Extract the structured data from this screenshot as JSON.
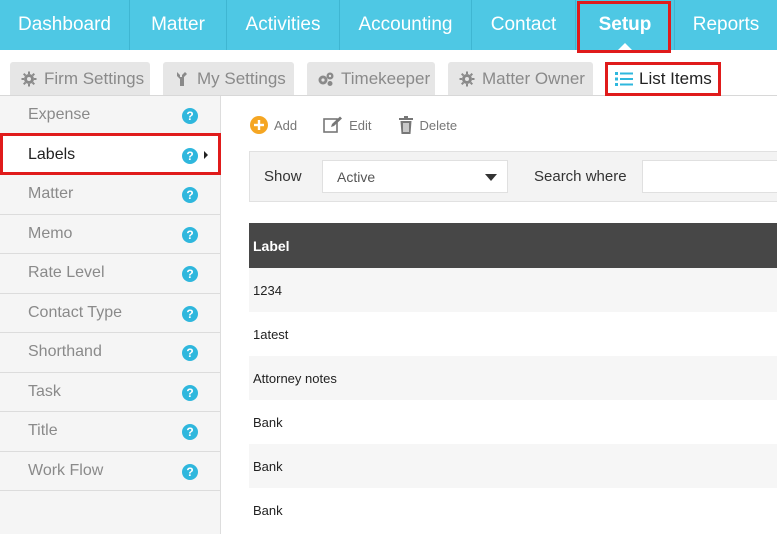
{
  "topnav": {
    "items": [
      {
        "label": "Dashboard"
      },
      {
        "label": "Matter"
      },
      {
        "label": "Activities"
      },
      {
        "label": "Accounting"
      },
      {
        "label": "Contact"
      },
      {
        "label": "Setup",
        "active": true
      },
      {
        "label": "Reports"
      }
    ]
  },
  "tabs": [
    {
      "label": "Firm Settings",
      "icon": "gear-icon"
    },
    {
      "label": "My Settings",
      "icon": "wrench-icon"
    },
    {
      "label": "Timekeeper",
      "icon": "gears-icon"
    },
    {
      "label": "Matter Owner",
      "icon": "gear-icon"
    },
    {
      "label": "List Items",
      "icon": "list-icon",
      "active": true
    }
  ],
  "sidebar": {
    "items": [
      {
        "label": "Expense"
      },
      {
        "label": "Labels",
        "active": true
      },
      {
        "label": "Matter"
      },
      {
        "label": "Memo"
      },
      {
        "label": "Rate Level"
      },
      {
        "label": "Contact Type"
      },
      {
        "label": "Shorthand"
      },
      {
        "label": "Task"
      },
      {
        "label": "Title"
      },
      {
        "label": "Work Flow"
      }
    ],
    "help_glyph": "?"
  },
  "toolbar": {
    "add_label": "Add",
    "edit_label": "Edit",
    "delete_label": "Delete"
  },
  "filter": {
    "show_label": "Show",
    "show_value": "Active",
    "search_label": "Search where"
  },
  "table": {
    "header": "Label",
    "rows": [
      "1234",
      "1atest",
      "Attorney notes",
      "Bank",
      "Bank",
      "Bank"
    ]
  },
  "colors": {
    "accent": "#4ec8e4",
    "highlight_box": "#e01b1b",
    "help_icon": "#2fb7dd",
    "add_icon": "#f5a623",
    "table_header": "#474747"
  }
}
